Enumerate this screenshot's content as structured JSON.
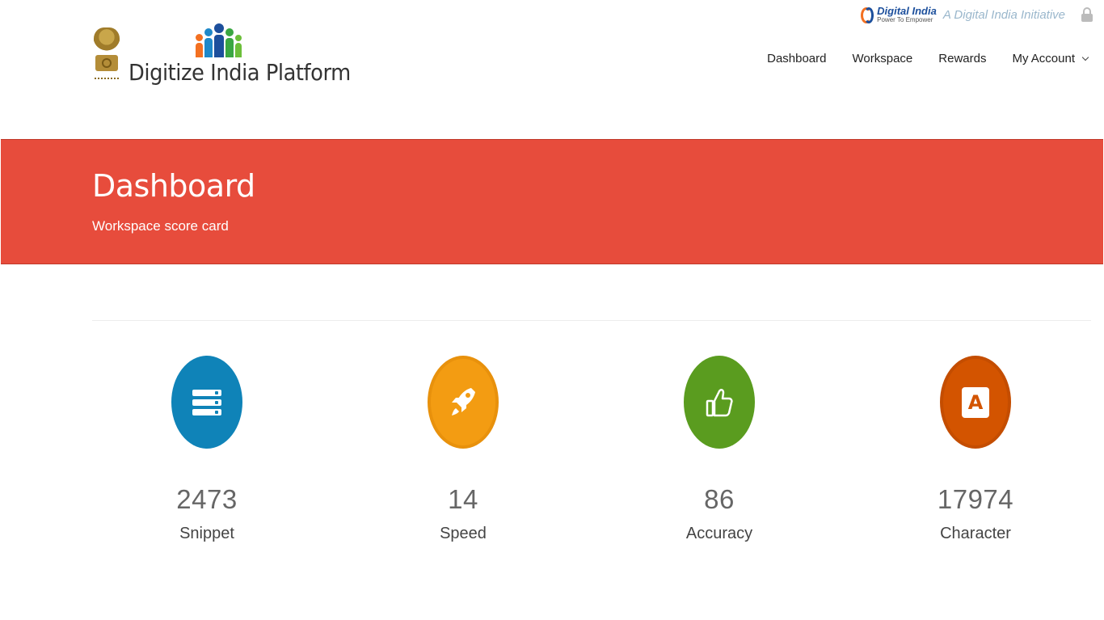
{
  "top_strip": {
    "digital_india_title": "Digital India",
    "digital_india_tagline": "Power To Empower",
    "initiative_text": "A Digital India Initiative"
  },
  "brand": {
    "name": "Digitize India Platform"
  },
  "nav": {
    "items": [
      {
        "label": "Dashboard"
      },
      {
        "label": "Workspace"
      },
      {
        "label": "Rewards"
      },
      {
        "label": "My Account"
      }
    ]
  },
  "banner": {
    "title": "Dashboard",
    "subtitle": "Workspace score card"
  },
  "stats": [
    {
      "value": "2473",
      "label": "Snippet",
      "icon": "server-icon",
      "color": "#0f83b8"
    },
    {
      "value": "14",
      "label": "Speed",
      "icon": "rocket-icon",
      "color": "#f39c12"
    },
    {
      "value": "86",
      "label": "Accuracy",
      "icon": "thumbs-up-icon",
      "color": "#5a9c1f"
    },
    {
      "value": "17974",
      "label": "Character",
      "icon": "character-a-icon",
      "color": "#d35400"
    }
  ],
  "colors": {
    "banner": "#e74c3c",
    "divider": "#ececec"
  }
}
